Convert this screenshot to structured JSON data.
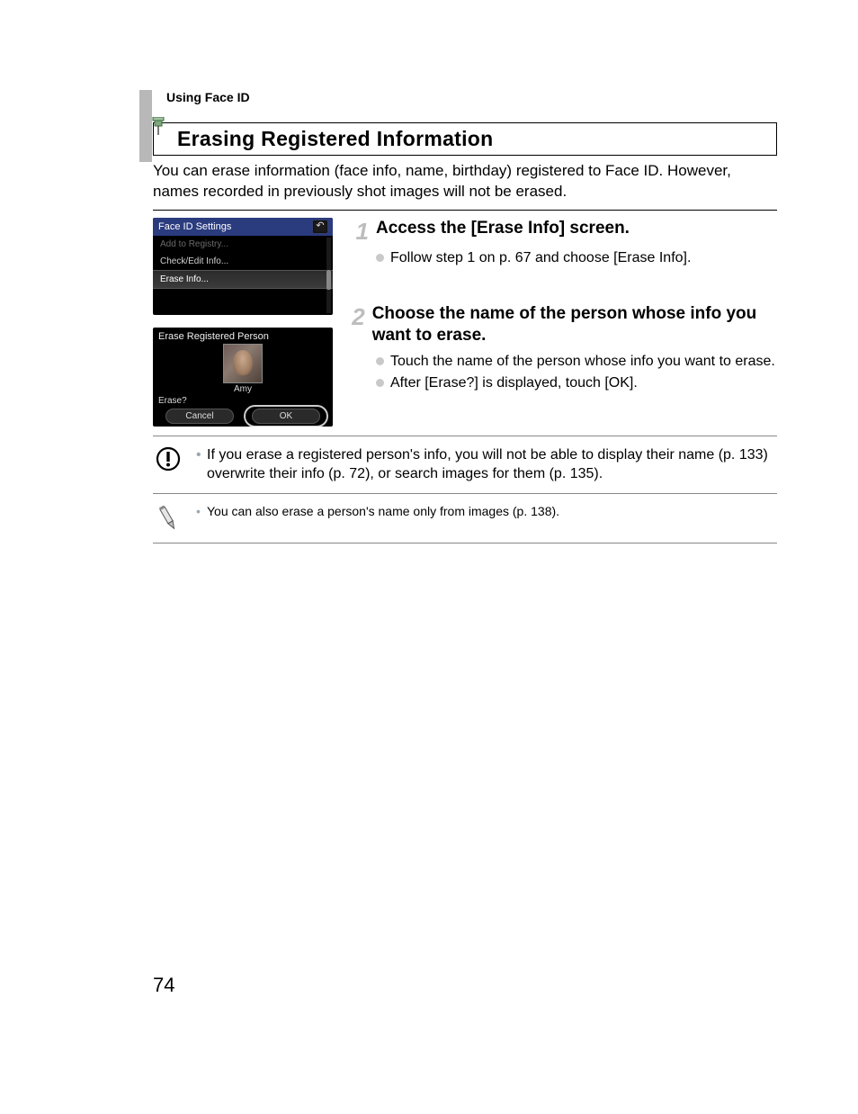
{
  "header": {
    "running_head": "Using Face ID",
    "section_title": "Erasing Registered Information",
    "intro": "You can erase information (face info, name, birthday) registered to Face ID. However, names recorded in previously shot images will not be erased."
  },
  "screenshots": {
    "menu": {
      "title": "Face ID Settings",
      "items": [
        {
          "label": "Add to Registry...",
          "state": "dim"
        },
        {
          "label": "Check/Edit Info...",
          "state": "normal"
        },
        {
          "label": "Erase Info...",
          "state": "selected"
        }
      ],
      "back_icon": "back-icon"
    },
    "erase": {
      "title": "Erase Registered Person",
      "person_name": "Amy",
      "prompt": "Erase?",
      "cancel": "Cancel",
      "ok": "OK"
    }
  },
  "steps": [
    {
      "num": "1",
      "title": "Access the [Erase Info] screen.",
      "bullets": [
        "Follow step 1 on p. 67 and choose [Erase Info]."
      ]
    },
    {
      "num": "2",
      "title": "Choose the name of the person whose info you want to erase.",
      "bullets": [
        "Touch the name of the person whose info you want to erase.",
        "After [Erase?] is displayed, touch [OK]."
      ]
    }
  ],
  "notes": {
    "caution": "If you erase a registered person's info, you will not be able to display their name (p. 133) overwrite their info (p. 72), or search images for them (p. 135).",
    "tip": "You can also erase a person's name only from images (p. 138)."
  },
  "page_number": "74"
}
